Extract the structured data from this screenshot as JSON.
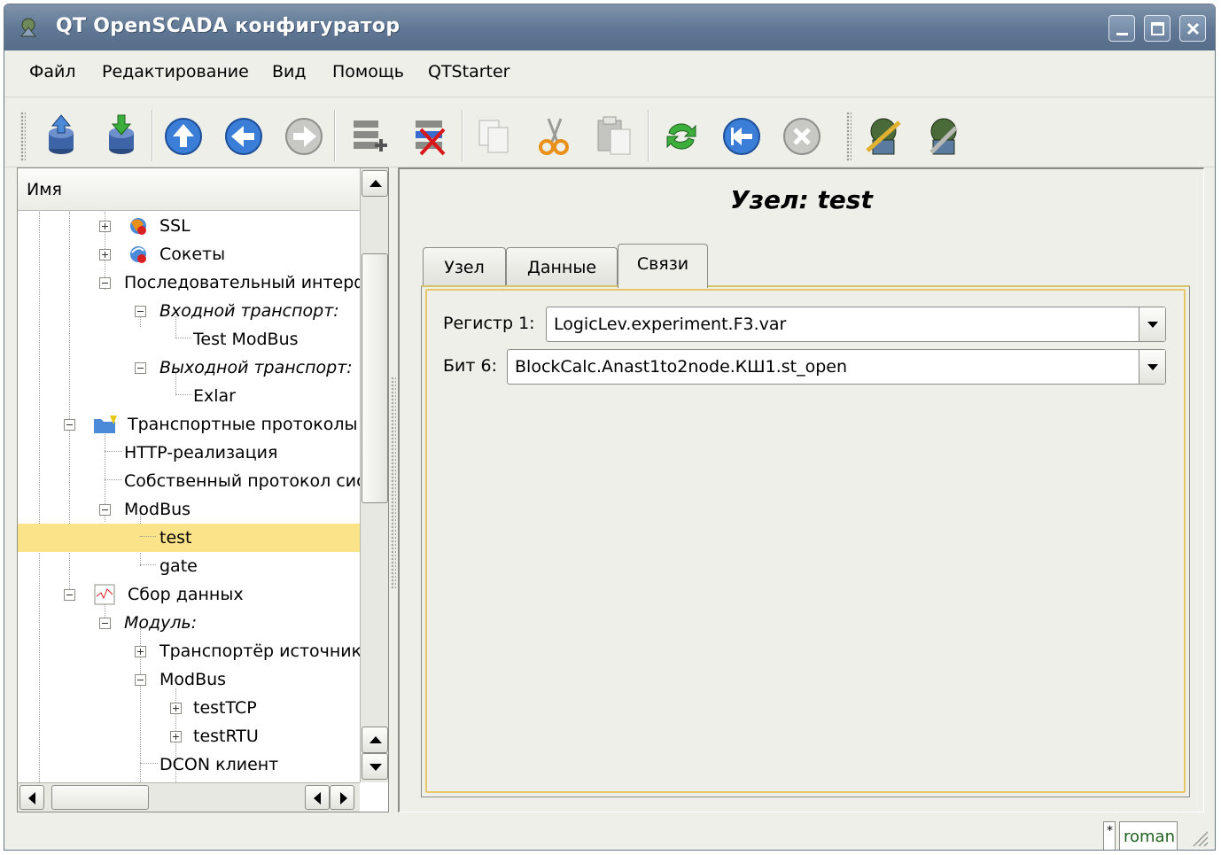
{
  "window": {
    "title": "QT OpenSCADA конфигуратор"
  },
  "menu": [
    "Файл",
    "Редактирование",
    "Вид",
    "Помощь",
    "QTStarter"
  ],
  "toolbar": {
    "icons": [
      "db-load-icon",
      "db-save-icon",
      "up-icon",
      "back-icon",
      "forward-icon",
      "add-item-icon",
      "delete-item-icon",
      "copy-icon",
      "cut-icon",
      "paste-icon",
      "refresh-icon",
      "start-icon",
      "stop-icon",
      "openscada-icon",
      "openscada-tools-icon"
    ]
  },
  "tree": {
    "header": "Имя",
    "items": [
      {
        "label": "SSL"
      },
      {
        "label": "Сокеты"
      },
      {
        "label": "Последовательный интерф"
      },
      {
        "label": "Входной транспорт:"
      },
      {
        "label": "Test ModBus"
      },
      {
        "label": "Выходной транспорт:"
      },
      {
        "label": "Exlar"
      },
      {
        "label": "Транспортные протоколы"
      },
      {
        "label": "HTTP-реализация"
      },
      {
        "label": "Собственный протокол сис"
      },
      {
        "label": "ModBus"
      },
      {
        "label": "test"
      },
      {
        "label": "gate"
      },
      {
        "label": "Сбор данных"
      },
      {
        "label": "Модуль:"
      },
      {
        "label": "Транспортёр источник"
      },
      {
        "label": "ModBus"
      },
      {
        "label": "testTCP"
      },
      {
        "label": "testRTU"
      },
      {
        "label": "DCON клиент"
      }
    ]
  },
  "panel": {
    "title": "Узел: test",
    "tabs": [
      "Узел",
      "Данные",
      "Связи"
    ],
    "active_tab": "Связи",
    "fields": [
      {
        "label": "Регистр 1:",
        "value": "LogicLev.experiment.F3.var"
      },
      {
        "label": "Бит 6:",
        "value": "BlockCalc.Anast1to2node.КШ1.st_open"
      }
    ]
  },
  "status": {
    "indicator": "*",
    "user": "roman"
  }
}
